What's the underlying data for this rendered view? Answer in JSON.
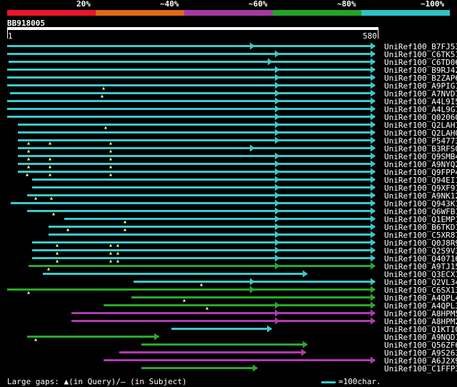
{
  "legend": {
    "items": [
      {
        "label": "20%",
        "color": "#e8152b"
      },
      {
        "label": "~40%",
        "color": "#e06a18"
      },
      {
        "label": "~60%",
        "color": "#a33aa0"
      },
      {
        "label": "~80%",
        "color": "#23a328"
      },
      {
        "label": "~100%",
        "color": "#2ec2c2"
      }
    ]
  },
  "query": {
    "id": "BB918005",
    "start": "1",
    "end": "580"
  },
  "hits": [
    {
      "label": "UniRef100_B7FJ53",
      "color": "#3ec8c8"
    },
    {
      "label": "UniRef100_C6TK51",
      "color": "#3ec8c8"
    },
    {
      "label": "UniRef100_C6TD06",
      "color": "#3ec8c8"
    },
    {
      "label": "UniRef100_B9RJ42",
      "color": "#3ec8c8"
    },
    {
      "label": "UniRef100_B2ZAP6",
      "color": "#3ec8c8"
    },
    {
      "label": "UniRef100_A9PIG1",
      "color": "#3ec8c8"
    },
    {
      "label": "UniRef100_A7NVD7",
      "color": "#3ec8c8"
    },
    {
      "label": "UniRef100_A4L9I5",
      "color": "#3ec8c8"
    },
    {
      "label": "UniRef100_A4L9G7",
      "color": "#3ec8c8"
    },
    {
      "label": "UniRef100_Q02060",
      "color": "#3ec8c8"
    },
    {
      "label": "UniRef100_Q2LAH1",
      "color": "#3ec8c8"
    },
    {
      "label": "UniRef100_Q2LAH0",
      "color": "#3ec8c8"
    },
    {
      "label": "UniRef100_P54773",
      "color": "#3ec8c8"
    },
    {
      "label": "UniRef100_B3RFS0",
      "color": "#3ec8c8"
    },
    {
      "label": "UniRef100_Q9SMB4",
      "color": "#3ec8c8"
    },
    {
      "label": "UniRef100_A9NYQ2",
      "color": "#3ec8c8"
    },
    {
      "label": "UniRef100_Q9FPP4",
      "color": "#3ec8c8"
    },
    {
      "label": "UniRef100_Q94EI1",
      "color": "#3ec8c8"
    },
    {
      "label": "UniRef100_Q9XF91",
      "color": "#3ec8c8"
    },
    {
      "label": "UniRef100_A9NK12",
      "color": "#3ec8c8"
    },
    {
      "label": "UniRef100_Q943K1",
      "color": "#3ec8c8"
    },
    {
      "label": "UniRef100_Q6WFB1",
      "color": "#3ec8c8"
    },
    {
      "label": "UniRef100_Q1EMP1",
      "color": "#3ec8c8"
    },
    {
      "label": "UniRef100_B6TKD1",
      "color": "#3ec8c8"
    },
    {
      "label": "UniRef100_C5XR87",
      "color": "#3ec8c8"
    },
    {
      "label": "UniRef100_Q0J8R9",
      "color": "#3ec8c8"
    },
    {
      "label": "UniRef100_Q2S9V3",
      "color": "#3ec8c8"
    },
    {
      "label": "UniRef100_Q40716",
      "color": "#3ec8c8"
    },
    {
      "label": "UniRef100_A9TJ15",
      "color": "#2aa82a"
    },
    {
      "label": "UniRef100_Q3ECX1",
      "color": "#3ec8c8"
    },
    {
      "label": "UniRef100_Q2VL34",
      "color": "#3ec8c8"
    },
    {
      "label": "UniRef100_C6SX13",
      "color": "#2aa82a"
    },
    {
      "label": "UniRef100_A4QPL4",
      "color": "#2aa82a"
    },
    {
      "label": "UniRef100_A4QPL3",
      "color": "#2aa82a"
    },
    {
      "label": "UniRef100_A8HPM5",
      "color": "#b03ab0"
    },
    {
      "label": "UniRef100_A8HPM2",
      "color": "#b03ab0"
    },
    {
      "label": "UniRef100_Q1KTI0",
      "color": "#3ec8c8"
    },
    {
      "label": "UniRef100_A9NQD1",
      "color": "#2aa82a"
    },
    {
      "label": "UniRef100_Q56ZF6",
      "color": "#2aa82a"
    },
    {
      "label": "UniRef100_A9S263",
      "color": "#b03ab0"
    },
    {
      "label": "UniRef100_A6J2X9",
      "color": "#b03ab0"
    },
    {
      "label": "UniRef100_C1FFP3",
      "color": "#2aa82a"
    }
  ],
  "footer": {
    "gaps_text": "Large gaps: ▲(in Query)/– (in Subject)",
    "scale_text": "=100char."
  }
}
